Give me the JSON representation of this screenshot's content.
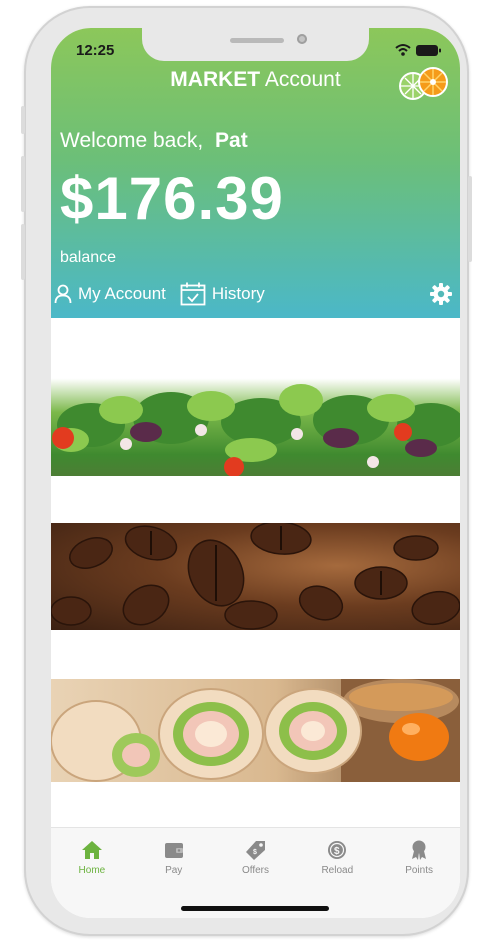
{
  "status_bar": {
    "time": "12:25"
  },
  "header": {
    "title_bold": "MARKET",
    "title_rest": "Account",
    "welcome": "Welcome back,",
    "user_name": "Pat",
    "balance": "$176.39",
    "balance_label": "balance",
    "my_account_label": "My Account",
    "history_label": "History"
  },
  "banners": [
    {
      "name": "salad"
    },
    {
      "name": "coffee-beans"
    },
    {
      "name": "wraps"
    }
  ],
  "tabbar": {
    "items": [
      {
        "label": "Home",
        "icon": "home-icon",
        "active": true
      },
      {
        "label": "Pay",
        "icon": "wallet-icon",
        "active": false
      },
      {
        "label": "Offers",
        "icon": "tag-icon",
        "active": false
      },
      {
        "label": "Reload",
        "icon": "reload-coin-icon",
        "active": false
      },
      {
        "label": "Points",
        "icon": "award-icon",
        "active": false
      }
    ]
  },
  "colors": {
    "header_top": "#8cc75a",
    "header_bottom": "#4bb8c8",
    "accent": "#6cb33f",
    "tab_inactive": "#8a8a8a"
  }
}
